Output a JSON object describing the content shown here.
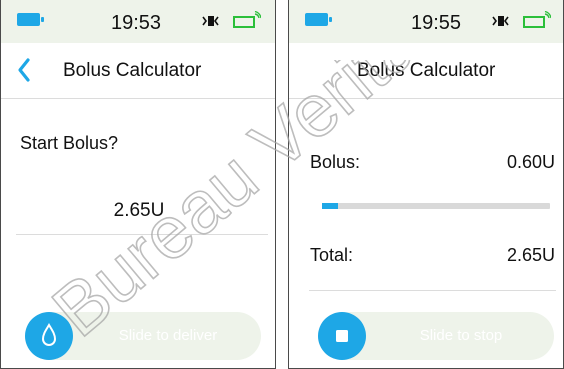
{
  "colors": {
    "accent": "#1ea7e6",
    "statusbar": "#eef3ea",
    "signal_green": "#2bbf3a",
    "watermark": "#a7a7a7"
  },
  "left_screen": {
    "status": {
      "time": "19:53"
    },
    "title": "Bolus Calculator",
    "prompt": "Start Bolus?",
    "amount": "2.65U",
    "slider": {
      "label": "Slide to deliver",
      "icon": "drop-icon"
    }
  },
  "right_screen": {
    "status": {
      "time": "19:55"
    },
    "title": "Bolus Calculator",
    "bolus": {
      "label": "Bolus:",
      "value": "0.60U",
      "progress_fraction": 0.07
    },
    "total": {
      "label": "Total:",
      "value": "2.65U"
    },
    "slider": {
      "label": "Slide to stop",
      "icon": "stop-icon"
    }
  },
  "watermark": {
    "text": "Bureau Veritas"
  }
}
